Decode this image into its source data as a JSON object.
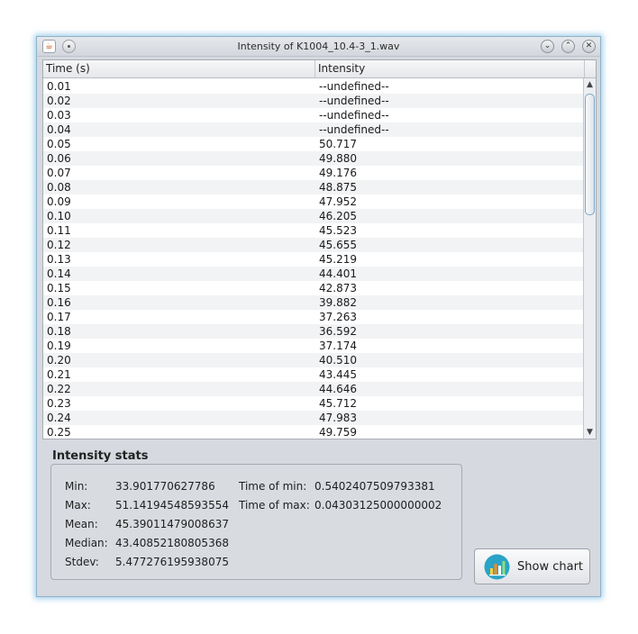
{
  "window": {
    "title": "Intensity of K1004_10.4-3_1.wav",
    "app_icon": "java-icon",
    "controls": {
      "minimize": "⌄",
      "maximize": "⌃",
      "close": "✕"
    }
  },
  "table": {
    "columns": [
      "Time (s)",
      "Intensity"
    ],
    "rows": [
      [
        "0.01",
        "--undefined--"
      ],
      [
        "0.02",
        "--undefined--"
      ],
      [
        "0.03",
        "--undefined--"
      ],
      [
        "0.04",
        "--undefined--"
      ],
      [
        "0.05",
        "50.717"
      ],
      [
        "0.06",
        "49.880"
      ],
      [
        "0.07",
        "49.176"
      ],
      [
        "0.08",
        "48.875"
      ],
      [
        "0.09",
        "47.952"
      ],
      [
        "0.10",
        "46.205"
      ],
      [
        "0.11",
        "45.523"
      ],
      [
        "0.12",
        "45.655"
      ],
      [
        "0.13",
        "45.219"
      ],
      [
        "0.14",
        "44.401"
      ],
      [
        "0.15",
        "42.873"
      ],
      [
        "0.16",
        "39.882"
      ],
      [
        "0.17",
        "37.263"
      ],
      [
        "0.18",
        "36.592"
      ],
      [
        "0.19",
        "37.174"
      ],
      [
        "0.20",
        "40.510"
      ],
      [
        "0.21",
        "43.445"
      ],
      [
        "0.22",
        "44.646"
      ],
      [
        "0.23",
        "45.712"
      ],
      [
        "0.24",
        "47.983"
      ],
      [
        "0.25",
        "49.759"
      ]
    ]
  },
  "stats": {
    "title": "Intensity stats",
    "min_label": "Min:",
    "min_value": "33.901770627786",
    "max_label": "Max:",
    "max_value": "51.14194548593554",
    "mean_label": "Mean:",
    "mean_value": "45.39011479008637",
    "median_label": "Median:",
    "median_value": "43.40852180805368",
    "stdev_label": "Stdev:",
    "stdev_value": "5.477276195938075",
    "time_min_label": "Time of min:",
    "time_min_value": "0.5402407509793381",
    "time_max_label": "Time of max:",
    "time_max_value": "0.04303125000000002"
  },
  "chart_button": {
    "label": "Show chart",
    "icon": "bar-chart-icon"
  },
  "colors": {
    "accent": "#2aa3c7",
    "window_bg": "#d6d9df"
  }
}
